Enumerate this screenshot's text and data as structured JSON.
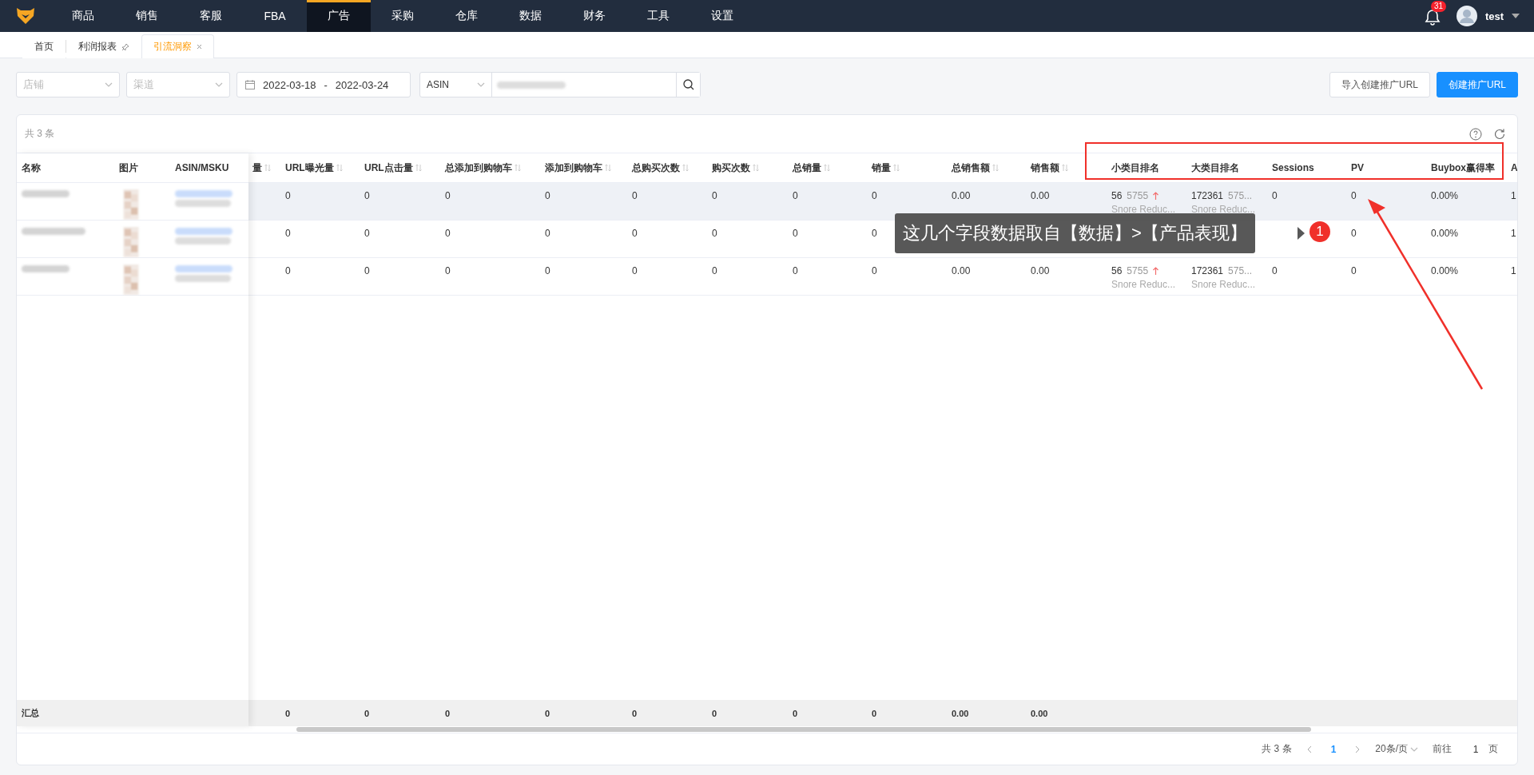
{
  "nav": {
    "items": [
      {
        "label": "商品",
        "selected": false
      },
      {
        "label": "销售",
        "selected": false
      },
      {
        "label": "客服",
        "selected": false
      },
      {
        "label": "FBA",
        "selected": false
      },
      {
        "label": "广告",
        "selected": true
      },
      {
        "label": "采购",
        "selected": false
      },
      {
        "label": "仓库",
        "selected": false
      },
      {
        "label": "数据",
        "selected": false
      },
      {
        "label": "财务",
        "selected": false
      },
      {
        "label": "工具",
        "selected": false
      },
      {
        "label": "设置",
        "selected": false
      }
    ],
    "notifications": "31",
    "user": "test"
  },
  "tabs": [
    {
      "label": "首页",
      "selected": false,
      "pinned": false,
      "closable": false
    },
    {
      "label": "利润报表",
      "selected": false,
      "pinned": true,
      "closable": false
    },
    {
      "label": "引流洞察",
      "selected": true,
      "pinned": false,
      "closable": true
    }
  ],
  "filters": {
    "shop": {
      "placeholder": "店铺"
    },
    "channel": {
      "placeholder": "渠道"
    },
    "date_range": {
      "start": "2022-03-18",
      "separator": "-",
      "end": "2022-03-24"
    },
    "search_type": {
      "value": "ASIN"
    }
  },
  "buttons": [
    {
      "label": "导入创建推广URL",
      "kind": "default"
    },
    {
      "label": "创建推广URL",
      "kind": "primary"
    }
  ],
  "table": {
    "count": "共 3 条",
    "fixed_columns": [
      "名称",
      "图片",
      "ASIN/MSKU"
    ],
    "columns": [
      {
        "label": "量",
        "sortable": true
      },
      {
        "label": "URL曝光量",
        "sortable": true
      },
      {
        "label": "URL点击量",
        "sortable": true
      },
      {
        "label": "总添加到购物车",
        "sortable": true
      },
      {
        "label": "添加到购物车",
        "sortable": true
      },
      {
        "label": "总购买次数",
        "sortable": true
      },
      {
        "label": "购买次数",
        "sortable": true
      },
      {
        "label": "总销量",
        "sortable": true
      },
      {
        "label": "销量",
        "sortable": true
      },
      {
        "label": "总销售额",
        "sortable": true
      },
      {
        "label": "销售额",
        "sortable": true
      },
      {
        "label": "小类目排名",
        "sortable": false
      },
      {
        "label": "大类目排名",
        "sortable": false
      },
      {
        "label": "Sessions",
        "sortable": false
      },
      {
        "label": "PV",
        "sortable": false
      },
      {
        "label": "Buybox赢得率",
        "sortable": false
      },
      {
        "label": "A",
        "sortable": false
      }
    ],
    "rows": [
      {
        "hovered": true,
        "cells": [
          {
            "kind": "empty"
          },
          {
            "kind": "text",
            "text": "0"
          },
          {
            "kind": "text",
            "text": "0"
          },
          {
            "kind": "text",
            "text": "0"
          },
          {
            "kind": "text",
            "text": "0"
          },
          {
            "kind": "text",
            "text": "0"
          },
          {
            "kind": "text",
            "text": "0"
          },
          {
            "kind": "text",
            "text": "0"
          },
          {
            "kind": "text",
            "text": "0"
          },
          {
            "kind": "text",
            "text": "0.00"
          },
          {
            "kind": "text",
            "text": "0.00"
          },
          {
            "kind": "rank",
            "rank": "56",
            "total": "5755",
            "rising": true,
            "category": "Snore Reduc..."
          },
          {
            "kind": "rank",
            "rank": "172361",
            "total": "575...",
            "rising": false,
            "category": "Snore Reduc..."
          },
          {
            "kind": "text",
            "text": "0"
          },
          {
            "kind": "text",
            "text": "0"
          },
          {
            "kind": "text",
            "text": "0.00%"
          },
          {
            "kind": "text",
            "text": "1"
          }
        ]
      },
      {
        "hovered": false,
        "cells": [
          {
            "kind": "empty"
          },
          {
            "kind": "text",
            "text": "0"
          },
          {
            "kind": "text",
            "text": "0"
          },
          {
            "kind": "text",
            "text": "0"
          },
          {
            "kind": "text",
            "text": "0"
          },
          {
            "kind": "text",
            "text": "0"
          },
          {
            "kind": "text",
            "text": "0"
          },
          {
            "kind": "text",
            "text": "0"
          },
          {
            "kind": "text",
            "text": "0"
          },
          {
            "kind": "empty"
          },
          {
            "kind": "empty"
          },
          {
            "kind": "empty"
          },
          {
            "kind": "empty"
          },
          {
            "kind": "empty"
          },
          {
            "kind": "text",
            "text": "0"
          },
          {
            "kind": "text",
            "text": "0.00%"
          },
          {
            "kind": "text",
            "text": "1"
          }
        ]
      },
      {
        "hovered": false,
        "cells": [
          {
            "kind": "empty"
          },
          {
            "kind": "text",
            "text": "0"
          },
          {
            "kind": "text",
            "text": "0"
          },
          {
            "kind": "text",
            "text": "0"
          },
          {
            "kind": "text",
            "text": "0"
          },
          {
            "kind": "text",
            "text": "0"
          },
          {
            "kind": "text",
            "text": "0"
          },
          {
            "kind": "text",
            "text": "0"
          },
          {
            "kind": "text",
            "text": "0"
          },
          {
            "kind": "text",
            "text": "0.00"
          },
          {
            "kind": "text",
            "text": "0.00"
          },
          {
            "kind": "rank",
            "rank": "56",
            "total": "5755",
            "rising": true,
            "category": "Snore Reduc..."
          },
          {
            "kind": "rank",
            "rank": "172361",
            "total": "575...",
            "rising": false,
            "category": "Snore Reduc..."
          },
          {
            "kind": "text",
            "text": "0"
          },
          {
            "kind": "text",
            "text": "0"
          },
          {
            "kind": "text",
            "text": "0.00%"
          },
          {
            "kind": "text",
            "text": "1"
          }
        ]
      }
    ],
    "summary": {
      "label": "汇总",
      "cells": [
        {
          "kind": "empty"
        },
        {
          "kind": "text",
          "text": "0"
        },
        {
          "kind": "text",
          "text": "0"
        },
        {
          "kind": "text",
          "text": "0"
        },
        {
          "kind": "text",
          "text": "0"
        },
        {
          "kind": "text",
          "text": "0"
        },
        {
          "kind": "text",
          "text": "0"
        },
        {
          "kind": "text",
          "text": "0"
        },
        {
          "kind": "text",
          "text": "0"
        },
        {
          "kind": "text",
          "text": "0.00"
        },
        {
          "kind": "text",
          "text": "0.00"
        }
      ]
    }
  },
  "pagination": {
    "total": "共 3 条",
    "pages": [
      {
        "label": "1",
        "selected": true
      }
    ],
    "page_size": "20条/页",
    "goto_label": "前往",
    "goto_value": "1",
    "page_unit": "页"
  },
  "annotation": {
    "text": "这几个字段数据取自【数据】>【产品表现】",
    "badge": "1"
  }
}
